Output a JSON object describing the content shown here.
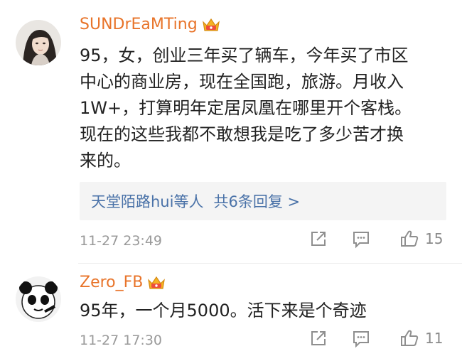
{
  "comments": [
    {
      "username": "SUNDrEaMTing",
      "badge_icon": "crown-badge-icon",
      "content_lines": [
        "95，女，创业三年买了辆车，今年买了市区",
        "中心的商业房，现在全国跑，旅游。月收入",
        "1W+，打算明年定居凤凰在哪里开个客栈。",
        "现在的这些我都不敢想我是吃了多少苦才换",
        "来的。"
      ],
      "replies": {
        "names": "天堂陌路hui等人",
        "count_text": "共6条回复 >"
      },
      "time": "11-27 23:49",
      "likes": "15"
    },
    {
      "username": "Zero_FB",
      "badge_icon": "crown-badge-icon",
      "content_lines": [
        "95年，一个月5000。活下来是个奇迹"
      ],
      "time": "11-27 17:30",
      "likes": "11"
    }
  ],
  "colors": {
    "username": "#e8742a",
    "reply_link": "#4a72a8",
    "meta": "#9a9a9a",
    "reply_bg": "#f4f4f4"
  }
}
